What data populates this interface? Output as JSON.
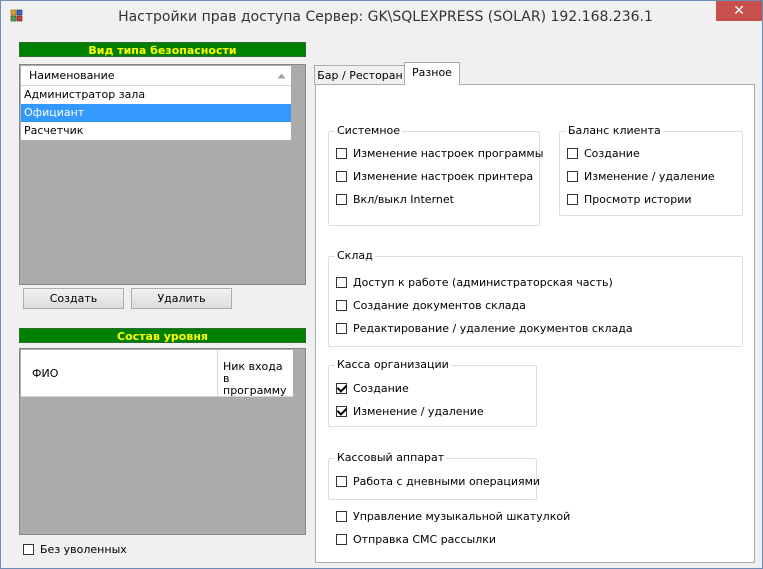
{
  "window": {
    "title": "Настройки прав доступа  Сервер: GK\\SQLEXPRESS (SOLAR) 192.168.236.1",
    "close_glyph": "✕"
  },
  "left": {
    "security_header": "Вид типа безопасности",
    "types_column": "Наименование",
    "types": [
      {
        "label": "Администратор зала",
        "selected": false
      },
      {
        "label": "Официант",
        "selected": true
      },
      {
        "label": "Расчетчик",
        "selected": false
      }
    ],
    "create_button": "Создать",
    "delete_button": "Удалить",
    "level_header": "Состав уровня",
    "level_columns": [
      "ФИО",
      "Ник входа в программу"
    ],
    "no_fired_label": "Без уволенных"
  },
  "tabs": [
    "Бар / Ресторан",
    "Разное"
  ],
  "active_tab": "Разное",
  "groups": {
    "system": {
      "title": "Системное",
      "items": [
        {
          "label": "Изменение настроек программы",
          "checked": false
        },
        {
          "label": "Изменение настроек принтера",
          "checked": false
        },
        {
          "label": "Вкл/выкл Internet",
          "checked": false
        }
      ]
    },
    "balance": {
      "title": "Баланс клиента",
      "items": [
        {
          "label": "Создание",
          "checked": false
        },
        {
          "label": "Изменение / удаление",
          "checked": false
        },
        {
          "label": "Просмотр истории",
          "checked": false
        }
      ]
    },
    "warehouse": {
      "title": "Склад",
      "items": [
        {
          "label": "Доступ к работе (администраторская часть)",
          "checked": false
        },
        {
          "label": "Создание документов склада",
          "checked": false
        },
        {
          "label": "Редактирование / удаление документов склада",
          "checked": false
        }
      ]
    },
    "cashbox": {
      "title": "Касса организации",
      "items": [
        {
          "label": "Создание",
          "checked": true
        },
        {
          "label": "Изменение / удаление",
          "checked": true
        }
      ]
    },
    "register": {
      "title": "Кассовый аппарат",
      "items": [
        {
          "label": "Работа с дневными операциями",
          "checked": false
        }
      ]
    }
  },
  "extra": [
    {
      "label": "Управление музыкальной шкатулкой",
      "checked": false
    },
    {
      "label": "Отправка СМС рассылки",
      "checked": false
    }
  ],
  "icons": [
    "app-icon",
    "sort-up-icon",
    "close-icon"
  ]
}
